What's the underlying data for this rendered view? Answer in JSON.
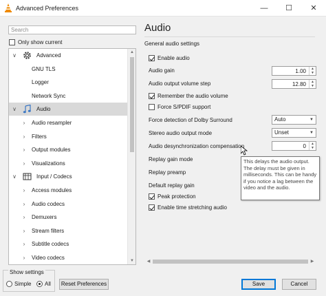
{
  "window": {
    "title": "Advanced Preferences"
  },
  "sidebar": {
    "search_placeholder": "Search",
    "only_current_label": "Only show current",
    "only_current_checked": false,
    "items": [
      {
        "label": "Advanced",
        "level": 0,
        "expander": "expanded",
        "icon": "gear-icon"
      },
      {
        "label": "GNU TLS",
        "level": 1,
        "expander": "none"
      },
      {
        "label": "Logger",
        "level": 1,
        "expander": "none"
      },
      {
        "label": "Network Sync",
        "level": 1,
        "expander": "none"
      },
      {
        "label": "Audio",
        "level": 0,
        "expander": "expanded",
        "icon": "music-note-icon",
        "selected": true
      },
      {
        "label": "Audio resampler",
        "level": 1,
        "expander": "collapsed"
      },
      {
        "label": "Filters",
        "level": 1,
        "expander": "collapsed"
      },
      {
        "label": "Output modules",
        "level": 1,
        "expander": "collapsed"
      },
      {
        "label": "Visualizations",
        "level": 1,
        "expander": "collapsed"
      },
      {
        "label": "Input / Codecs",
        "level": 0,
        "expander": "expanded",
        "icon": "input-codecs-icon"
      },
      {
        "label": "Access modules",
        "level": 1,
        "expander": "collapsed"
      },
      {
        "label": "Audio codecs",
        "level": 1,
        "expander": "collapsed"
      },
      {
        "label": "Demuxers",
        "level": 1,
        "expander": "collapsed"
      },
      {
        "label": "Stream filters",
        "level": 1,
        "expander": "collapsed"
      },
      {
        "label": "Subtitle codecs",
        "level": 1,
        "expander": "collapsed"
      },
      {
        "label": "Video codecs",
        "level": 1,
        "expander": "collapsed"
      }
    ]
  },
  "show_settings": {
    "legend": "Show settings",
    "simple_label": "Simple",
    "all_label": "All",
    "selected": "All"
  },
  "buttons": {
    "reset": "Reset Preferences",
    "save": "Save",
    "cancel": "Cancel"
  },
  "panel": {
    "title": "Audio",
    "subtitle": "General audio settings",
    "enable_audio": {
      "label": "Enable audio",
      "checked": true
    },
    "audio_gain": {
      "label": "Audio gain",
      "value": "1.00"
    },
    "volume_step": {
      "label": "Audio output volume step",
      "value": "12.80"
    },
    "remember_volume": {
      "label": "Remember the audio volume",
      "checked": true
    },
    "force_spdif": {
      "label": "Force S/PDIF support",
      "checked": false
    },
    "dolby": {
      "label": "Force detection of Dolby Surround",
      "value": "Auto"
    },
    "stereo_mode": {
      "label": "Stereo audio output mode",
      "value": "Unset"
    },
    "desync": {
      "label": "Audio desynchronization compensation",
      "value": "0"
    },
    "replay_gain_mode": {
      "label": "Replay gain mode"
    },
    "replay_preamp": {
      "label": "Replay preamp"
    },
    "default_replay_gain": {
      "label": "Default replay gain"
    },
    "peak_protection": {
      "label": "Peak protection",
      "checked": true
    },
    "time_stretching": {
      "label": "Enable time stretching audio",
      "checked": true
    },
    "tooltip": "This delays the audio output. The delay must be given in milliseconds. This can be handy if you notice a lag between the video and the audio."
  }
}
